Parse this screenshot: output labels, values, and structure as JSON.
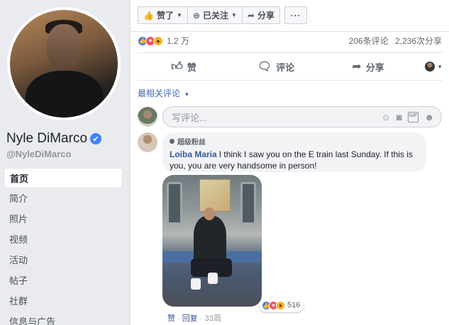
{
  "profile": {
    "name": "Nyle DiMarco",
    "handle": "@NyleDiMarco",
    "verified_glyph": "✔",
    "nav": [
      "首页",
      "简介",
      "照片",
      "视频",
      "活动",
      "帖子",
      "社群",
      "信息与广告"
    ],
    "active_nav": "首页"
  },
  "toolbar": {
    "liked_label": "赞了",
    "following_label": "已关注",
    "share_label": "分享",
    "more_label": "···"
  },
  "post": {
    "reaction_count": "1.2 万",
    "comments_count": "206条评论",
    "shares_count": "2,236次分享",
    "actions": {
      "like": "赞",
      "comment": "评论",
      "share": "分享"
    }
  },
  "comments": {
    "sort_label": "最相关评论",
    "input_placeholder": "写评论...",
    "items": [
      {
        "badge": "超级粉丝",
        "author": "Loiba Maria",
        "text": "I think I saw you on the E train last Sunday. If this is you, you are very handsome in person!",
        "reaction_count": "516",
        "like_label": "赞",
        "reply_label": "回复",
        "time": "33周"
      }
    ]
  },
  "colors": {
    "accent": "#4267b2",
    "like": "#4080ff",
    "love": "#f25268",
    "wow": "#f7b125"
  }
}
